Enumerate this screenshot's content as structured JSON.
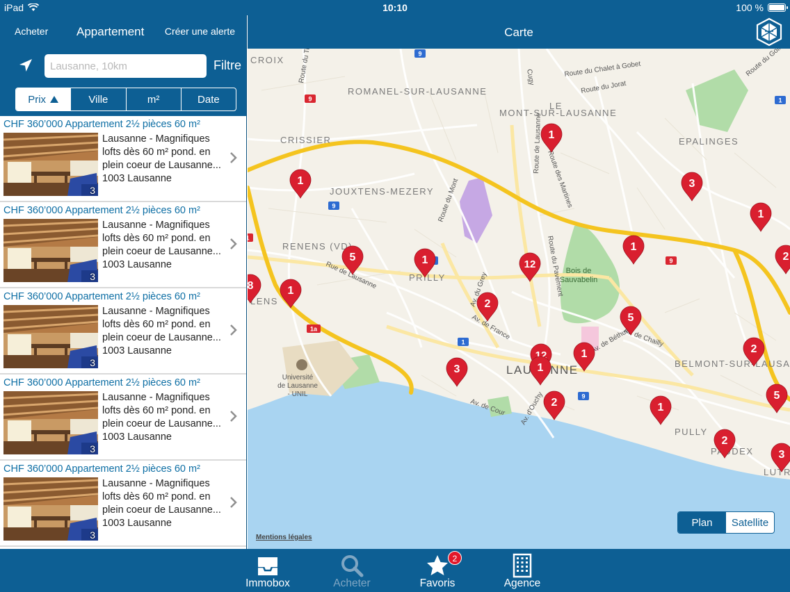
{
  "status": {
    "device": "iPad",
    "time": "10:10",
    "battery": "100 %"
  },
  "left": {
    "nav": {
      "back_label": "Acheter",
      "title": "Appartement",
      "alert_label": "Créer une alerte"
    },
    "search": {
      "placeholder": "Lausanne, 10km",
      "value": ""
    },
    "filter_label": "Filtre",
    "sort_tabs": [
      {
        "label": "Prix",
        "active": true
      },
      {
        "label": "Ville",
        "active": false
      },
      {
        "label": "m²",
        "active": false
      },
      {
        "label": "Date",
        "active": false
      }
    ],
    "listings": [
      {
        "price": "CHF 360’000 Appartement 2½ pièces 60 m²",
        "line1": "Lausanne - Magnifiques",
        "line2": "lofts dès 60 m² pond. en",
        "line3": "plein coeur de Lausanne...",
        "line4": "1003 Lausanne",
        "photos": "3"
      },
      {
        "price": "CHF 360’000 Appartement 2½ pièces 60 m²",
        "line1": "Lausanne - Magnifiques",
        "line2": "lofts dès 60 m² pond. en",
        "line3": "plein coeur de Lausanne...",
        "line4": "1003 Lausanne",
        "photos": "3"
      },
      {
        "price": "CHF 360’000 Appartement 2½ pièces 60 m²",
        "line1": "Lausanne - Magnifiques",
        "line2": "lofts dès 60 m² pond. en",
        "line3": "plein coeur de Lausanne...",
        "line4": "1003 Lausanne",
        "photos": "3"
      },
      {
        "price": "CHF 360’000 Appartement 2½ pièces 60 m²",
        "line1": "Lausanne - Magnifiques",
        "line2": "lofts dès 60 m² pond. en",
        "line3": "plein coeur de Lausanne...",
        "line4": "1003 Lausanne",
        "photos": "3"
      },
      {
        "price": "CHF 360’000 Appartement 2½ pièces 60 m²",
        "line1": "Lausanne - Magnifiques",
        "line2": "lofts dès 60 m² pond. en",
        "line3": "plein coeur de Lausanne...",
        "line4": "1003 Lausanne",
        "photos": "3"
      }
    ]
  },
  "map": {
    "title": "Carte",
    "toggle": [
      {
        "label": "Plan",
        "active": true
      },
      {
        "label": "Satellite",
        "active": false
      }
    ],
    "legal": "Mentions légales",
    "places": {
      "croix": "CROIX",
      "romanel": "ROMANEL-SUR-LAUSANNE",
      "mont": "LE",
      "mont2": "MONT-SUR-LAUSANNE",
      "crissier": "CRISSIER",
      "epalinges": "EPALINGES",
      "jouxtens": "JOUXTENS-MEZERY",
      "renens": "RENENS (VD)",
      "prilly": "PRILLY",
      "lens": "LENS",
      "lausanne": "LAUSANNE",
      "belmont": "BELMONT-SUR-LAUSAN",
      "pully": "PULLY",
      "paudex": "PAUDEX",
      "lutry": "LUTR",
      "bois1": "Bois de",
      "bois2": "Sauvabelin",
      "uni1": "Université",
      "uni2": "de Lausanne",
      "uni3": "- UNIL"
    },
    "streets": {
      "chalet": "Route du Chalet à Gobet",
      "jorat": "Route du Jorat",
      "golf": "Route du Golf",
      "tin": "Route du Tin",
      "cugy": "Cugy",
      "martines": "Route des Martines",
      "lausanne_r": "Route de Lausanne",
      "mont_r": "Route du Mont",
      "pavement": "Route du Pavement",
      "rue_lausanne": "Rue de Lausanne",
      "grey": "Av. du Grey",
      "france": "Av. de France",
      "chailly": "Av. de Chailly",
      "bethusy": "Av. de Béthusy",
      "cour": "Av. de Cour",
      "ouchy": "Av. d'Ouchy"
    },
    "route_shields": [
      "9",
      "9",
      "9",
      "1a",
      "1",
      "9",
      "5",
      "1",
      "9",
      "1"
    ],
    "pins": [
      "1",
      "1",
      "3",
      "1",
      "1",
      "5",
      "1",
      "12",
      "8",
      "1",
      "2",
      "5",
      "12",
      "1",
      "1",
      "3",
      "2",
      "1",
      "2",
      "2",
      "5",
      "3",
      "2"
    ]
  },
  "tabbar": {
    "tabs": [
      {
        "label": "Immobox",
        "icon": "inbox-icon"
      },
      {
        "label": "Acheter",
        "icon": "search-icon"
      },
      {
        "label": "Favoris",
        "icon": "star-icon",
        "badge": "2"
      },
      {
        "label": "Agence",
        "icon": "building-icon"
      }
    ]
  },
  "colors": {
    "brand": "#0d5f94",
    "pin": "#d91f2f",
    "water": "#a7d3f0",
    "park": "#a9dba3",
    "motorway": "#f6c627"
  }
}
